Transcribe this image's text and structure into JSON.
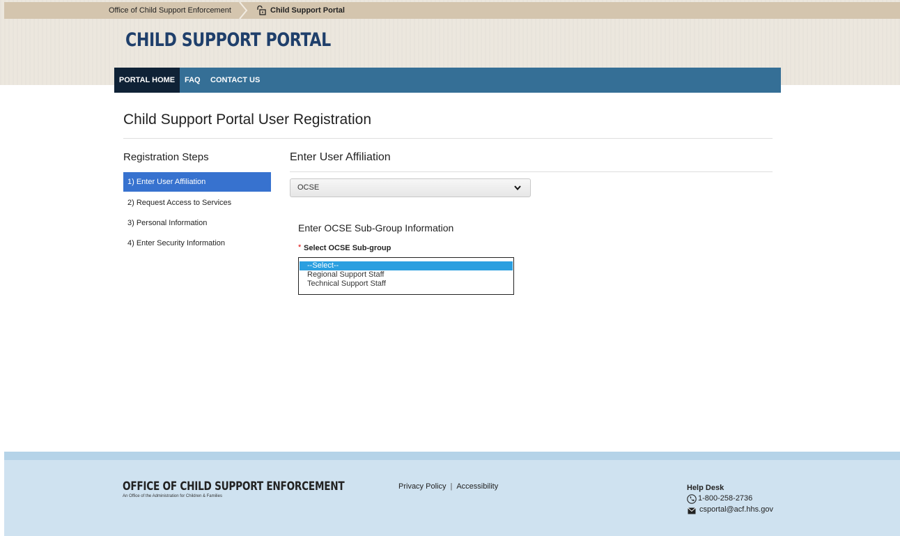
{
  "breadcrumb": {
    "office": "Office of Child Support Enforcement",
    "portal": "Child Support Portal"
  },
  "header": {
    "site_title": "CHILD SUPPORT PORTAL"
  },
  "nav": {
    "items": [
      "PORTAL HOME",
      "FAQ",
      "CONTACT US"
    ]
  },
  "main": {
    "page_title": "Child Support Portal User Registration",
    "steps_heading": "Registration Steps",
    "steps": [
      "1) Enter User Affiliation",
      "2) Request Access to Services",
      "3) Personal Information",
      "4) Enter Security Information"
    ],
    "active_step_index": 0,
    "section_heading": "Enter User Affiliation",
    "affiliation_value": "OCSE",
    "subgroup_heading": "Enter OCSE Sub-Group Information",
    "required_marker": "*",
    "subgroup_label": "Select OCSE Sub-group",
    "subgroup_options": [
      "--Select--",
      "Regional Support Staff",
      "Technical Support Staff"
    ],
    "subgroup_selected_index": 0
  },
  "footer": {
    "brand": "OFFICE OF CHILD SUPPORT ENFORCEMENT",
    "brand_sub": "An Office of the Administration for Children & Families",
    "privacy": "Privacy Policy",
    "separator": "|",
    "accessibility": "Accessibility",
    "help_title": "Help Desk",
    "help_phone": "1-800-258-2736",
    "help_email": "csportal@acf.hhs.gov"
  },
  "colors": {
    "nav_bg": "#356f96",
    "nav_active": "#0f2236",
    "step_active": "#3772cf",
    "option_selected": "#2b9fe0",
    "title": "#1f3f6b",
    "footer_bg": "#cfe2f0"
  },
  "icons": {
    "breadcrumb_separator": "chevron-right-icon",
    "portal": "lock-icon",
    "dropdown": "chevron-down-icon",
    "phone": "phone-icon",
    "email": "mail-icon"
  }
}
